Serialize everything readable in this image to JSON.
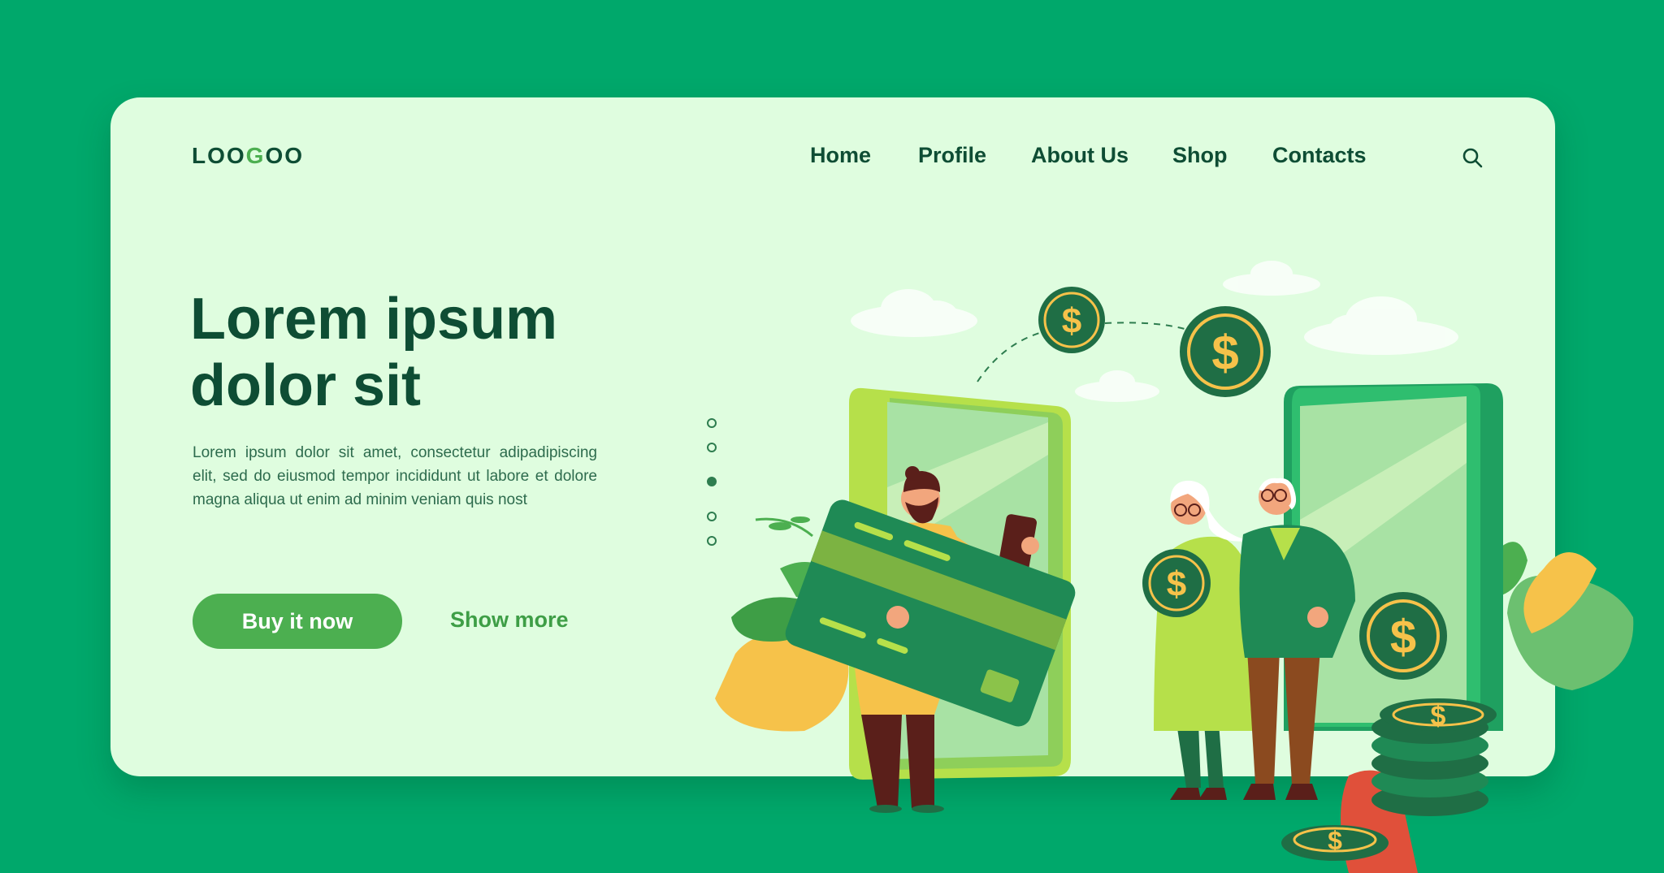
{
  "brand": {
    "logo_prefix": "LOO",
    "logo_g": "G",
    "logo_suffix": "OO"
  },
  "nav": {
    "items": [
      "Home",
      "Profile",
      "About Us",
      "Shop",
      "Contacts"
    ],
    "search_icon": "search-icon"
  },
  "hero": {
    "title_line1": "Lorem ipsum",
    "title_line2": "dolor sit",
    "text": "Lorem ipsum dolor sit amet, consectetur adipadipiscing elit, sed do eiusmod tempor incididunt ut labore et dolore magna aliqua ut enim ad minim veniam quis nost",
    "primary_button": "Buy it now",
    "secondary_button": "Show more"
  },
  "carousel": {
    "total": 5,
    "active_index": 2
  },
  "illustration": {
    "coin_symbol": "$"
  },
  "colors": {
    "background": "#00a86b",
    "card": "#dffddf",
    "text_dark": "#0e4d34",
    "accent": "#4caf50"
  }
}
